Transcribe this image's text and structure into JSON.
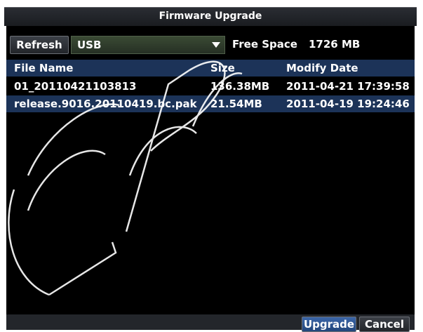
{
  "title": "Firmware Upgrade",
  "toolbar": {
    "refresh_label": "Refresh",
    "device_value": "USB",
    "free_space_label": "Free Space",
    "free_space_value": "1726 MB"
  },
  "table": {
    "columns": [
      "File Name",
      "Size",
      "Modify Date"
    ],
    "rows": [
      {
        "name": "01_20110421103813",
        "size": "136.38MB",
        "date": "2011-04-21 17:39:58"
      },
      {
        "name": "release.9016.20110419.bc.pak",
        "size": "21.54MB",
        "date": "2011-04-19 19:24:46"
      }
    ]
  },
  "footer": {
    "upgrade_label": "Upgrade",
    "cancel_label": "Cancel"
  }
}
